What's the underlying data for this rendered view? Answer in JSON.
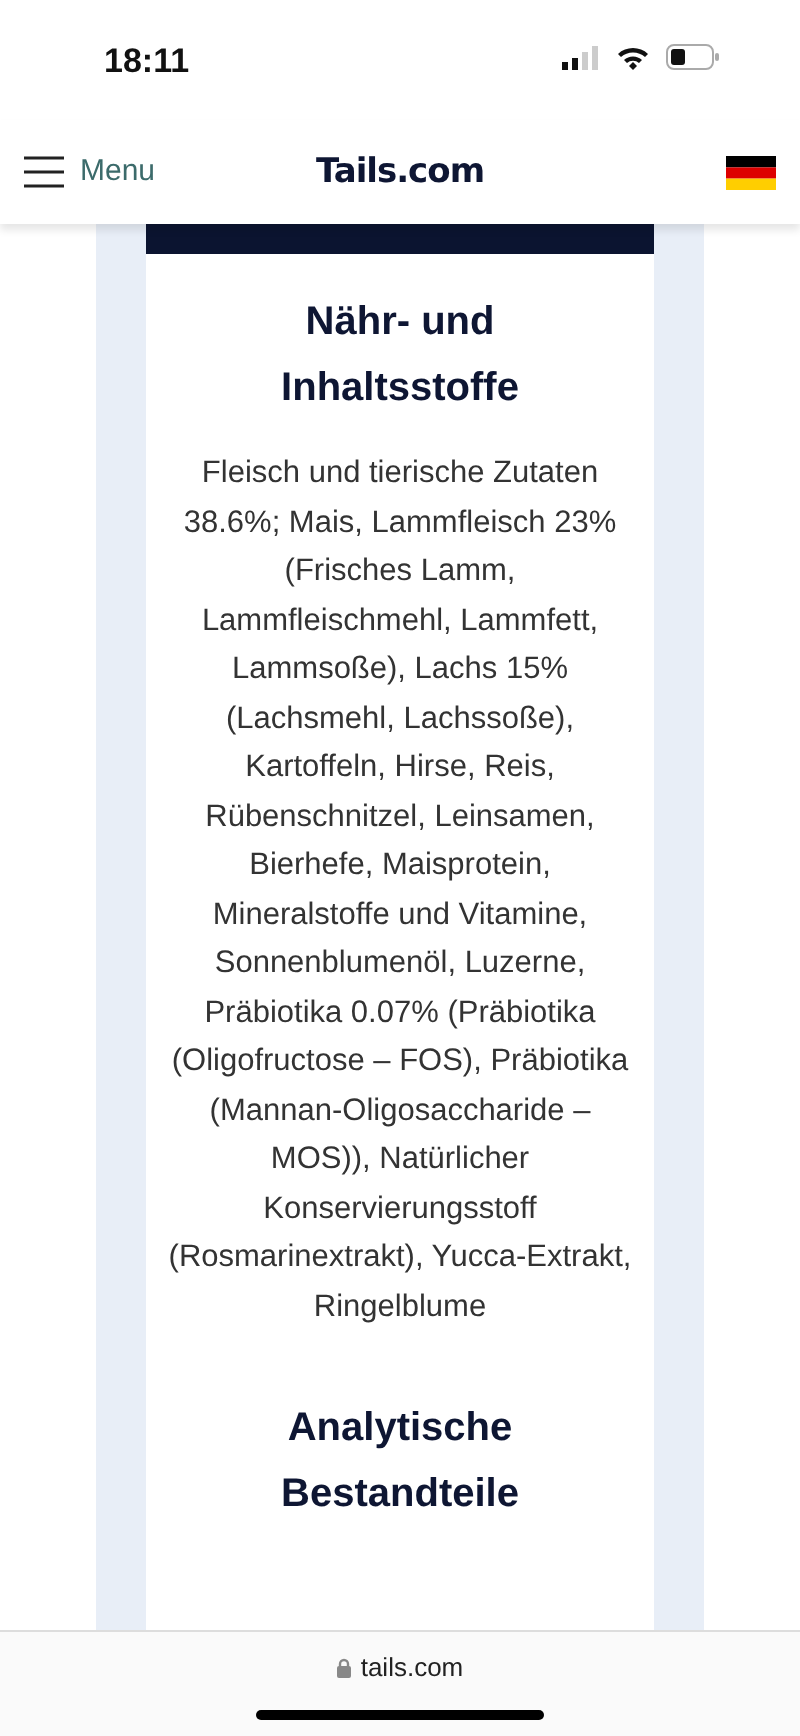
{
  "status_bar": {
    "time": "18:11"
  },
  "header": {
    "menu_label": "Menu",
    "logo": "Tails.com"
  },
  "section": {
    "heading": "Nähr- und Inhaltsstoffe",
    "text": "Fleisch und tierische Zutaten 38.6%; Mais, Lammfleisch 23% (Frisches Lamm, Lammfleischmehl, Lammfett, Lammsoße), Lachs 15% (Lachsmehl, Lachssoße), Kartoffeln, Hirse, Reis, Rübenschnitzel, Leinsamen, Bierhefe, Maisprotein, Mineralstoffe und Vitamine, Sonnenblumenöl, Luzerne, Präbiotika 0.07% (Präbiotika (Oligofructose – FOS), Präbiotika (Mannan-Oligosaccharide – MOS)), Natürlicher Konservierungsstoff (Rosmarinextrakt), Yucca-Extrakt, Ringelblume",
    "next_heading": "Analytische Bestandteile"
  },
  "browser_bar": {
    "url": "tails.com"
  }
}
